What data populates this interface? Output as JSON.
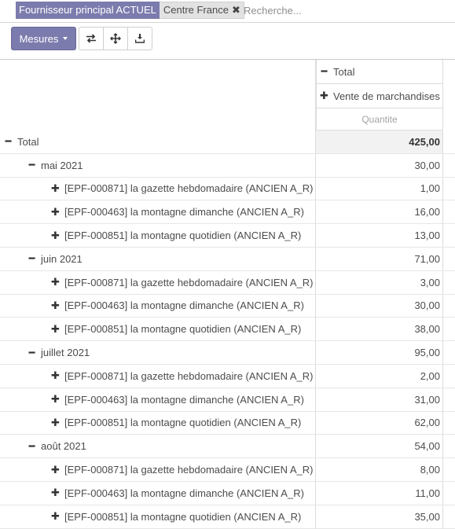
{
  "search": {
    "facet_category": "Fournisseur principal ACTUEL",
    "facet_value": "Centre France",
    "facet_close_icon": "close-icon",
    "placeholder": "Recherche..."
  },
  "toolbar": {
    "measures_label": "Mesures",
    "icons": [
      "swap-axes-icon",
      "expand-all-icon",
      "download-icon"
    ]
  },
  "pivot": {
    "col_header_total": "Total",
    "col_header_group": "Vente de marchandises",
    "measure": "Quantite",
    "total_label": "Total",
    "total_value": "425,00",
    "months": [
      {
        "label": "mai 2021",
        "value": "30,00",
        "items": [
          {
            "label": "[EPF-000871] la gazette hebdomadaire (ANCIEN A_R)",
            "value": "1,00"
          },
          {
            "label": "[EPF-000463] la montagne dimanche (ANCIEN A_R)",
            "value": "16,00"
          },
          {
            "label": "[EPF-000851] la montagne quotidien (ANCIEN A_R)",
            "value": "13,00"
          }
        ]
      },
      {
        "label": "juin 2021",
        "value": "71,00",
        "items": [
          {
            "label": "[EPF-000871] la gazette hebdomadaire (ANCIEN A_R)",
            "value": "3,00"
          },
          {
            "label": "[EPF-000463] la montagne dimanche (ANCIEN A_R)",
            "value": "30,00"
          },
          {
            "label": "[EPF-000851] la montagne quotidien (ANCIEN A_R)",
            "value": "38,00"
          }
        ]
      },
      {
        "label": "juillet 2021",
        "value": "95,00",
        "items": [
          {
            "label": "[EPF-000871] la gazette hebdomadaire (ANCIEN A_R)",
            "value": "2,00"
          },
          {
            "label": "[EPF-000463] la montagne dimanche (ANCIEN A_R)",
            "value": "31,00"
          },
          {
            "label": "[EPF-000851] la montagne quotidien (ANCIEN A_R)",
            "value": "62,00"
          }
        ]
      },
      {
        "label": "août 2021",
        "value": "54,00",
        "items": [
          {
            "label": "[EPF-000871] la gazette hebdomadaire (ANCIEN A_R)",
            "value": "8,00"
          },
          {
            "label": "[EPF-000463] la montagne dimanche (ANCIEN A_R)",
            "value": "11,00"
          },
          {
            "label": "[EPF-000851] la montagne quotidien (ANCIEN A_R)",
            "value": "35,00"
          }
        ]
      }
    ]
  }
}
